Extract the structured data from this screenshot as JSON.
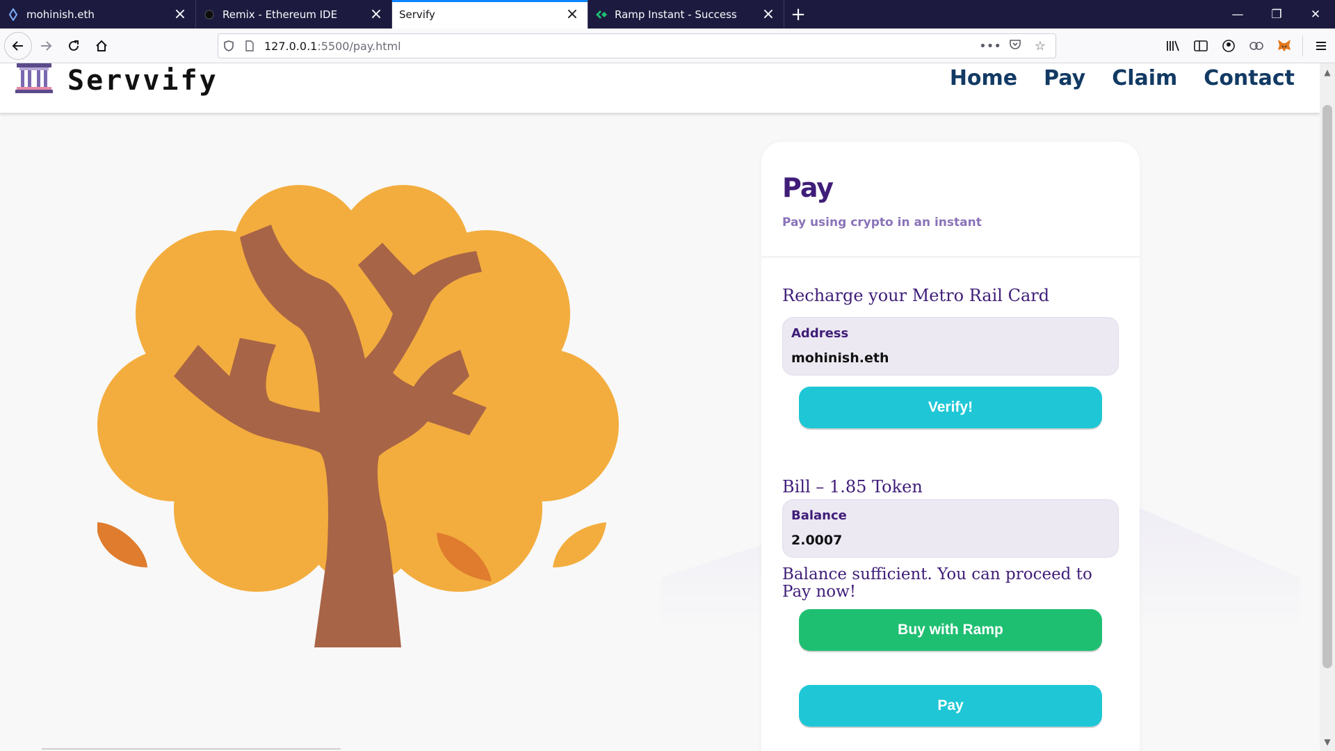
{
  "browser": {
    "tabs": [
      {
        "title": "mohinish.eth",
        "icon": "ens-icon",
        "active": false
      },
      {
        "title": "Remix - Ethereum IDE",
        "icon": "remix-icon",
        "active": false
      },
      {
        "title": "Servify",
        "icon": "",
        "active": true
      },
      {
        "title": "Ramp Instant - Success",
        "icon": "ramp-icon",
        "active": false
      }
    ],
    "url_host": "127.0.0.1",
    "url_rest": ":5500/pay.html"
  },
  "site": {
    "brand": "Servvify",
    "nav": [
      "Home",
      "Pay",
      "Claim",
      "Contact"
    ]
  },
  "pay": {
    "title": "Pay",
    "subtitle": "Pay using crypto in an instant",
    "recharge_label": "Recharge your Metro Rail Card",
    "address_label": "Address",
    "address_value": "mohinish.eth",
    "verify_button": "Verify!",
    "bill_label": "Bill – 1.85 Token",
    "balance_label": "Balance",
    "balance_value": "2.0007",
    "status_text": "Balance sufficient. You can proceed to Pay now!",
    "ramp_button": "Buy with Ramp",
    "pay_button": "Pay"
  },
  "colors": {
    "accent_purple": "#3f1d78",
    "nav_blue": "#123a63",
    "verify_cyan": "#1fc7d6",
    "ramp_green": "#1fbf72",
    "tree_orange": "#f3ad3e",
    "tree_trunk": "#a86446",
    "leaf_dark": "#df7c2e"
  }
}
